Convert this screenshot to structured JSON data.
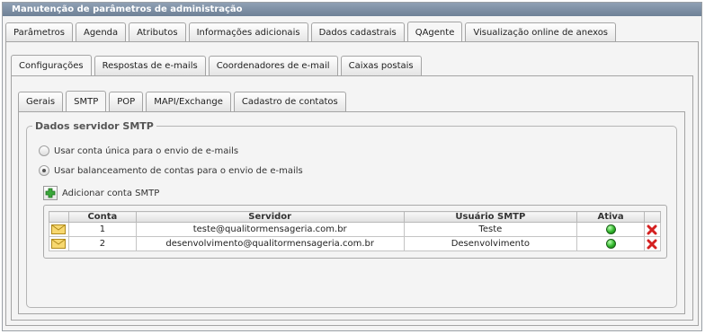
{
  "window": {
    "title": "Manutenção de parâmetros de administração"
  },
  "main_tabs": [
    {
      "label": "Parâmetros",
      "active": false
    },
    {
      "label": "Agenda",
      "active": false
    },
    {
      "label": "Atributos",
      "active": false
    },
    {
      "label": "Informações adicionais",
      "active": false
    },
    {
      "label": "Dados cadastrais",
      "active": false
    },
    {
      "label": "QAgente",
      "active": true
    },
    {
      "label": "Visualização online de anexos",
      "active": false
    }
  ],
  "sub_tabs": [
    {
      "label": "Configurações",
      "active": true
    },
    {
      "label": "Respostas de e-mails",
      "active": false
    },
    {
      "label": "Coordenadores de e-mail",
      "active": false
    },
    {
      "label": "Caixas postais",
      "active": false
    }
  ],
  "inner_tabs": [
    {
      "label": "Gerais",
      "active": false
    },
    {
      "label": "SMTP",
      "active": true
    },
    {
      "label": "POP",
      "active": false
    },
    {
      "label": "MAPI/Exchange",
      "active": false
    },
    {
      "label": "Cadastro de contatos",
      "active": false
    }
  ],
  "smtp_section": {
    "legend": "Dados servidor SMTP",
    "options": [
      {
        "label": "Usar conta única para o envio de e-mails",
        "checked": false
      },
      {
        "label": "Usar balanceamento de contas para o envio de e-mails",
        "checked": true
      }
    ],
    "add_button": "Adicionar conta SMTP",
    "table": {
      "headers": [
        "Conta",
        "Servidor",
        "Usuário SMTP",
        "Ativa"
      ],
      "rows": [
        {
          "conta": "1",
          "servidor": "teste@qualitormensageria.com.br",
          "usuario": "Teste",
          "ativa": true
        },
        {
          "conta": "2",
          "servidor": "desenvolvimento@qualitormensageria.com.br",
          "usuario": "Desenvolvimento",
          "ativa": true
        }
      ]
    }
  },
  "icons": {
    "row_icon": "envelope-icon",
    "active_icon": "green-dot-icon",
    "delete_icon": "delete-x-icon",
    "add_icon": "plus-icon"
  },
  "colors": {
    "titlebar": "#7a8ca1",
    "active_dot": "#2fb52a",
    "delete": "#d42020",
    "add": "#2e9a2e"
  }
}
